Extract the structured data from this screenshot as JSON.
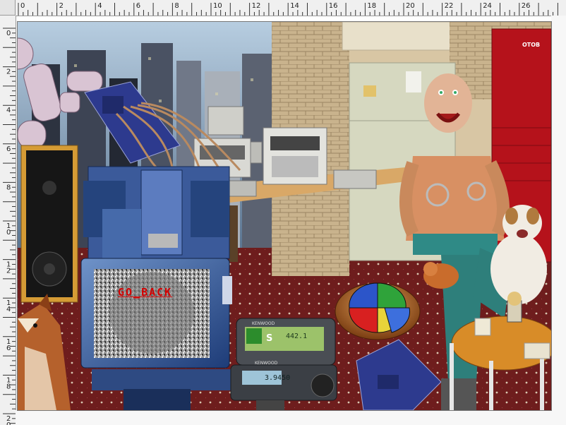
{
  "ruler": {
    "horizontal_labels": [
      "0",
      "2",
      "4",
      "6",
      "8",
      "10",
      "12",
      "14",
      "16",
      "18",
      "20",
      "22",
      "24",
      "26"
    ],
    "vertical_labels": [
      "0",
      "2",
      "4",
      "6",
      "8",
      "1\n0",
      "1\n2",
      "1\n4",
      "1\n6",
      "1\n8",
      "2\n0"
    ]
  },
  "artwork": {
    "tv_screen_text": "GO_BACK",
    "radio_display_main": "442.1",
    "radio_display_s": "S",
    "radio_display_secondary": "3.9450",
    "radio_brand_top": "KENWOOD",
    "radio_brand_bottom": "KENWOOD",
    "poster_text": "OTOB"
  },
  "colors": {
    "carpet": "#6e1d1d",
    "wall_brick": "#c9b38d",
    "fridge": "#d6d8c0",
    "counter": "#d9a867",
    "sky": "#8aa7c4",
    "toolbox_red": "#b5121b",
    "simon_red": "#d82020",
    "simon_blue": "#2c55c9",
    "simon_green": "#2fa33a",
    "simon_yellow": "#e8d33a"
  }
}
